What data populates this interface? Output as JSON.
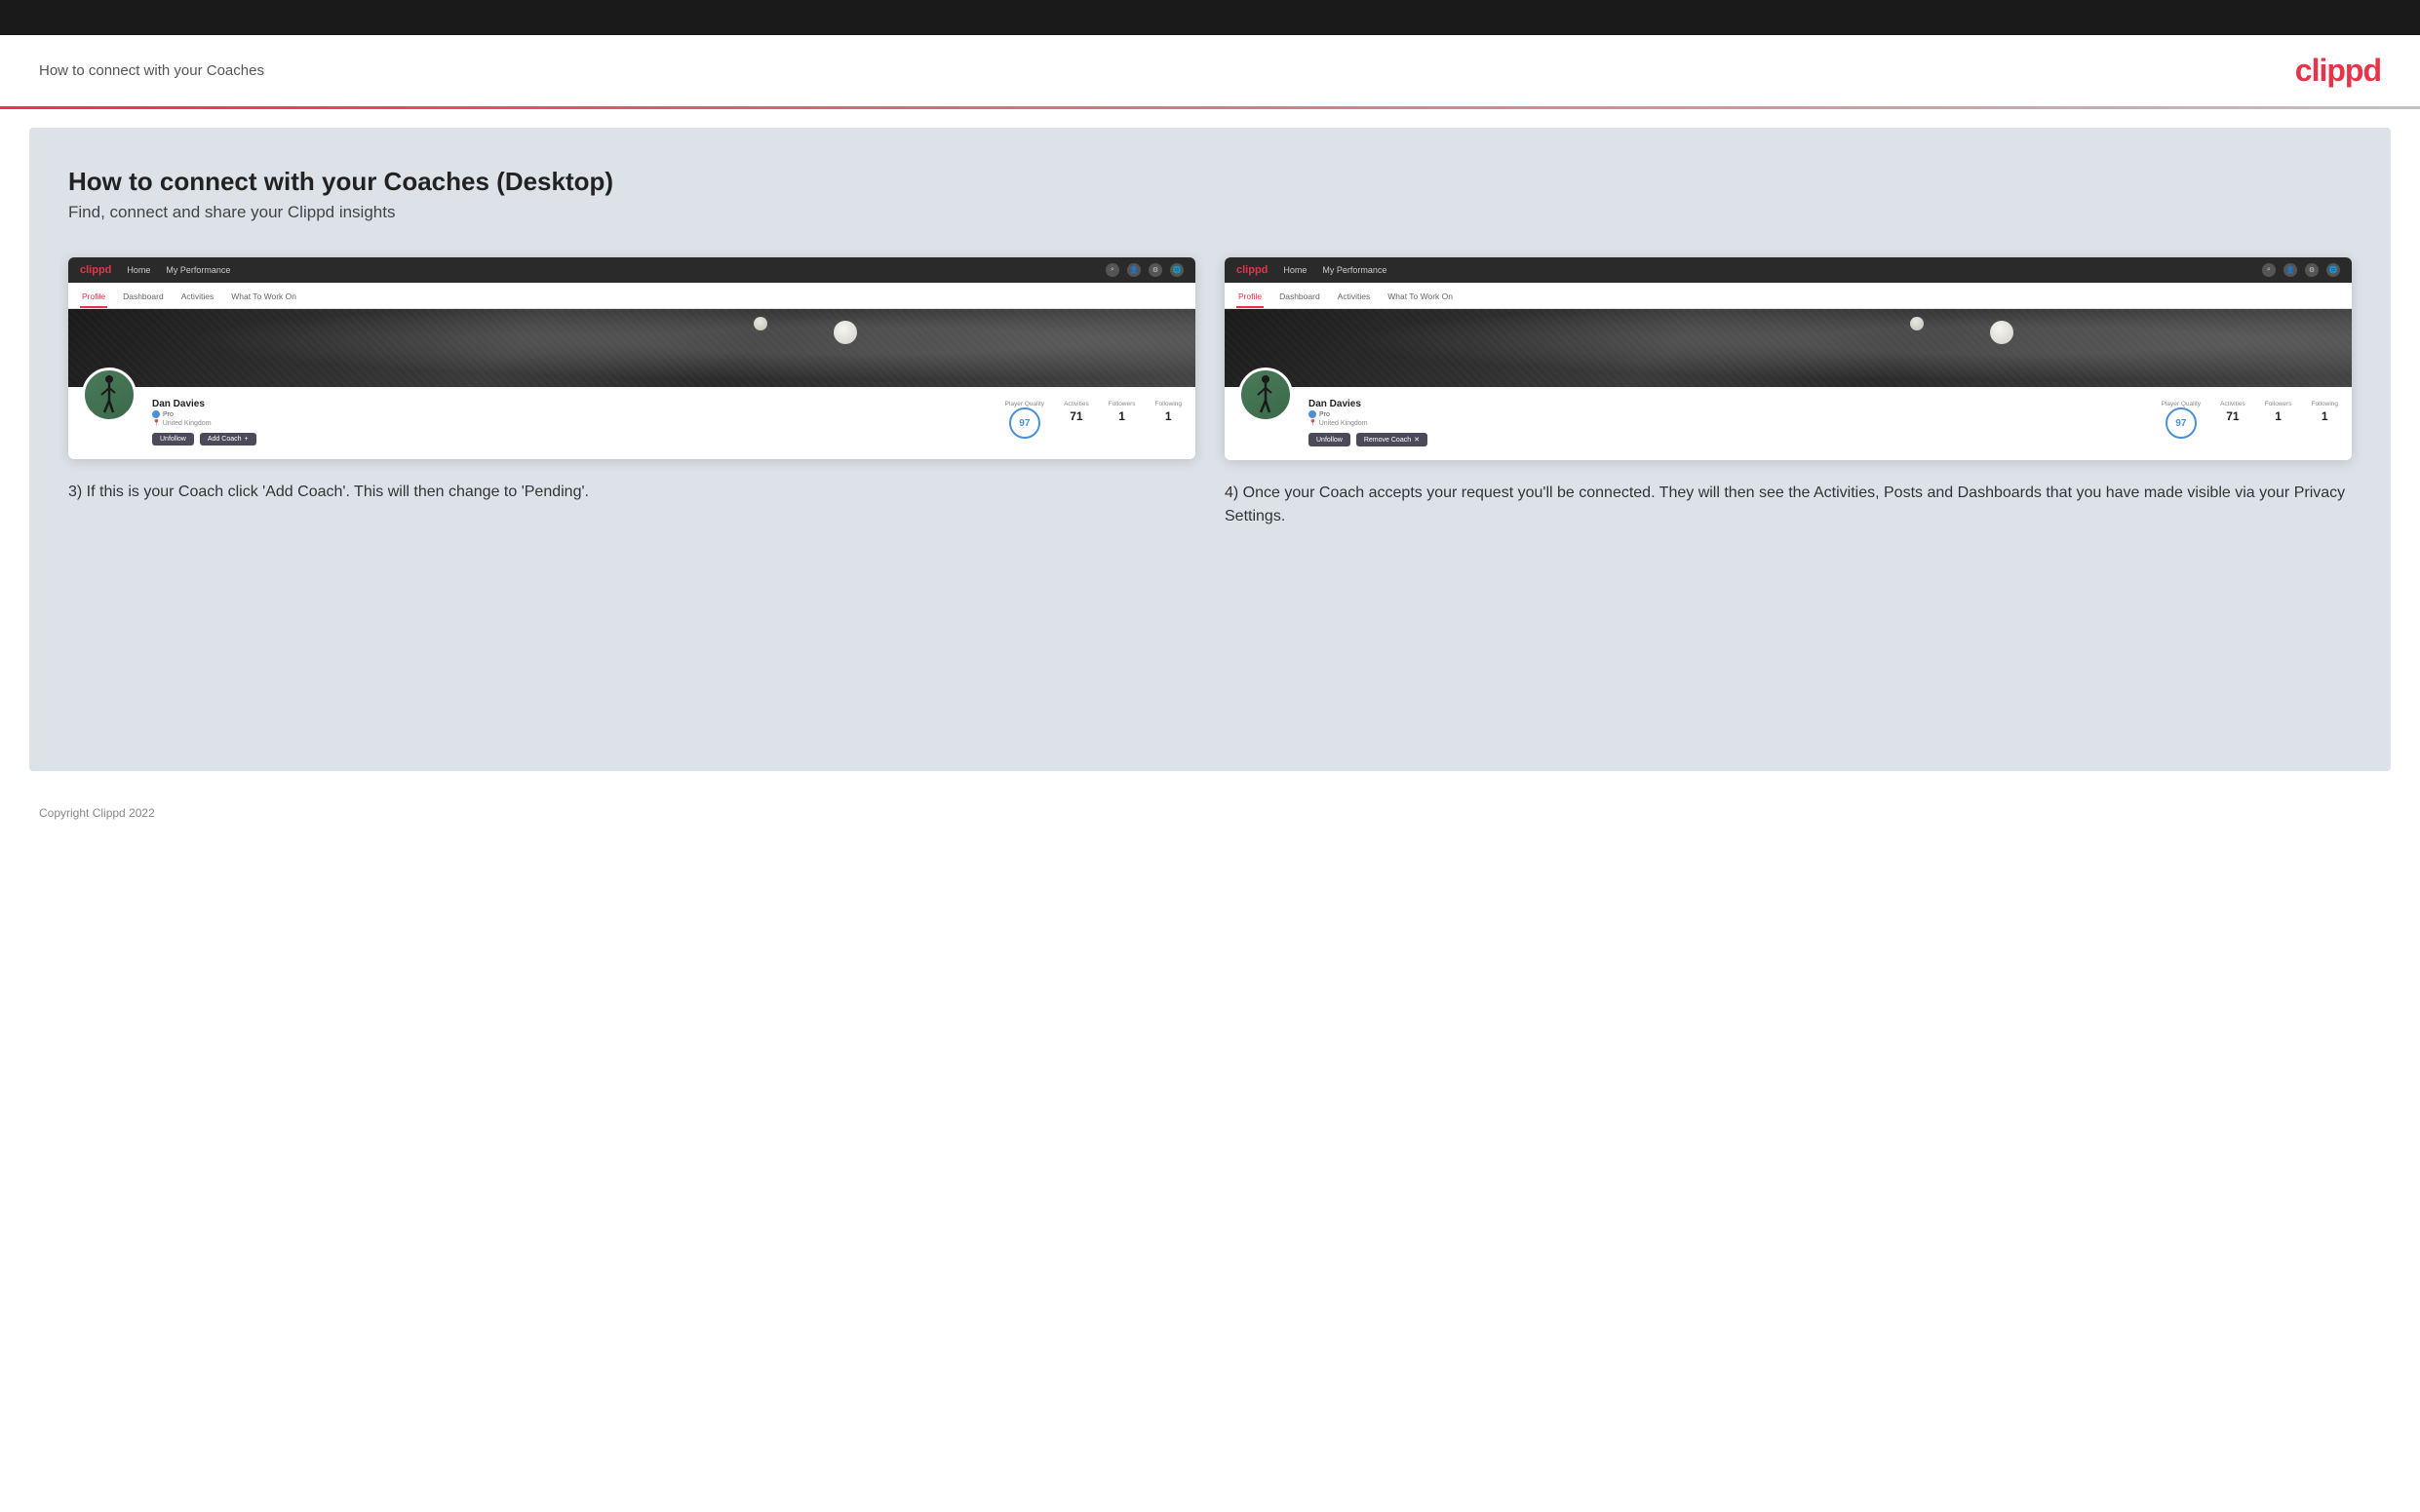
{
  "topBar": {},
  "header": {
    "title": "How to connect with your Coaches",
    "logo": "clippd"
  },
  "main": {
    "heading": "How to connect with your Coaches (Desktop)",
    "subheading": "Find, connect and share your Clippd insights",
    "screenshot1": {
      "nav": {
        "logo": "clippd",
        "items": [
          "Home",
          "My Performance"
        ]
      },
      "tabs": [
        "Profile",
        "Dashboard",
        "Activities",
        "What To Work On"
      ],
      "activeTab": "Profile",
      "playerName": "Dan Davies",
      "playerRole": "Pro",
      "playerLocation": "United Kingdom",
      "stats": {
        "playerQuality": "97",
        "playerQualityLabel": "Player Quality",
        "activities": "71",
        "activitiesLabel": "Activities",
        "followers": "1",
        "followersLabel": "Followers",
        "following": "1",
        "followingLabel": "Following"
      },
      "buttons": {
        "unfollow": "Unfollow",
        "addCoach": "Add Coach"
      }
    },
    "screenshot2": {
      "nav": {
        "logo": "clippd",
        "items": [
          "Home",
          "My Performance"
        ]
      },
      "tabs": [
        "Profile",
        "Dashboard",
        "Activities",
        "What To Work On"
      ],
      "activeTab": "Profile",
      "playerName": "Dan Davies",
      "playerRole": "Pro",
      "playerLocation": "United Kingdom",
      "stats": {
        "playerQuality": "97",
        "playerQualityLabel": "Player Quality",
        "activities": "71",
        "activitiesLabel": "Activities",
        "followers": "1",
        "followersLabel": "Followers",
        "following": "1",
        "followingLabel": "Following"
      },
      "buttons": {
        "unfollow": "Unfollow",
        "removeCoach": "Remove Coach"
      }
    },
    "caption1": "3) If this is your Coach click 'Add Coach'. This will then change to 'Pending'.",
    "caption2": "4) Once your Coach accepts your request you'll be connected. They will then see the Activities, Posts and Dashboards that you have made visible via your Privacy Settings.",
    "footer": "Copyright Clippd 2022"
  }
}
